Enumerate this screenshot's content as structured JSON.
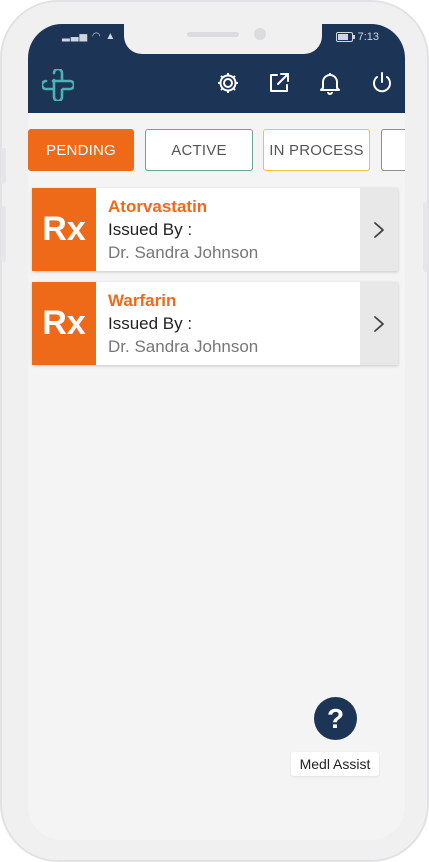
{
  "status_bar": {
    "time": "7:13"
  },
  "header": {
    "icons": [
      "app-logo-icon",
      "settings-icon",
      "share-external-icon",
      "notification-bell-icon",
      "power-icon"
    ]
  },
  "tabs": [
    {
      "label": "PENDING",
      "color": "#ef6a18"
    },
    {
      "label": "ACTIVE",
      "color": "#6fa39a"
    },
    {
      "label": "IN PROCESS",
      "color": "#e9c63a"
    },
    {
      "label": ""
    }
  ],
  "prescriptions": [
    {
      "badge": "Rx",
      "name": "Atorvastatin",
      "issued_label": "Issued By :",
      "doctor": "Dr. Sandra Johnson"
    },
    {
      "badge": "Rx",
      "name": "Warfarin",
      "issued_label": "Issued By :",
      "doctor": "Dr. Sandra Johnson"
    }
  ],
  "assist": {
    "icon": "?",
    "label": "Medl Assist"
  },
  "colors": {
    "header": "#1c3456",
    "accent": "#ef6a18",
    "background": "#f4f4f4"
  }
}
